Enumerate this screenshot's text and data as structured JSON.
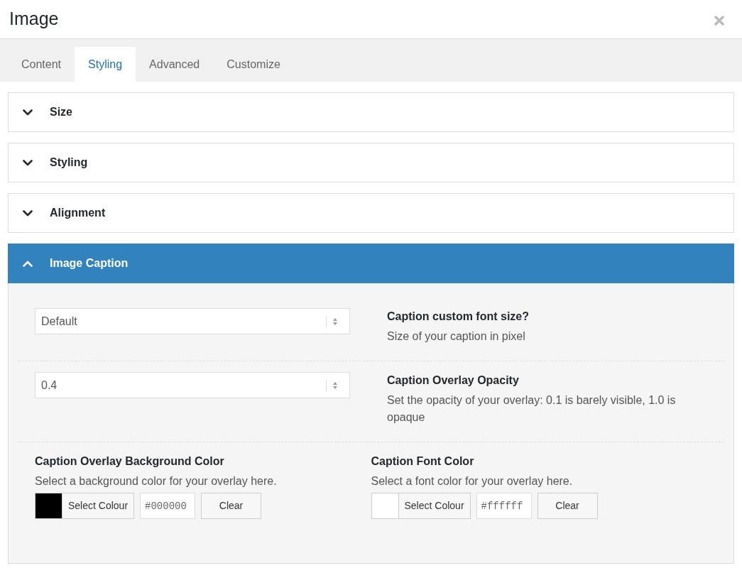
{
  "window": {
    "title": "Image"
  },
  "tabs": [
    {
      "label": "Content",
      "selected": false
    },
    {
      "label": "Styling",
      "selected": true
    },
    {
      "label": "Advanced",
      "selected": false
    },
    {
      "label": "Customize",
      "selected": false
    }
  ],
  "sections": [
    {
      "title": "Size",
      "expanded": false
    },
    {
      "title": "Styling",
      "expanded": false
    },
    {
      "title": "Alignment",
      "expanded": false
    },
    {
      "title": "Image Caption",
      "expanded": true,
      "fields": [
        {
          "kind": "select",
          "value": "Default",
          "label": "Caption custom font size?",
          "description": "Size of your caption in pixel"
        },
        {
          "kind": "select",
          "value": "0.4",
          "label": "Caption Overlay Opacity",
          "description": "Set the opacity of your overlay: 0.1 is barely visible, 1.0 is opaque"
        },
        {
          "kind": "colors",
          "pickers": [
            {
              "label": "Caption Overlay Background Color",
              "description": "Select a background color for your overlay here.",
              "color": "#000000",
              "button": "Select Colour",
              "value": "#000000",
              "clear": "Clear"
            },
            {
              "label": "Caption Font Color",
              "description": "Select a font color for your overlay here.",
              "color": "#ffffff",
              "button": "Select Colour",
              "value": "#ffffff",
              "clear": "Clear"
            }
          ]
        }
      ]
    }
  ]
}
